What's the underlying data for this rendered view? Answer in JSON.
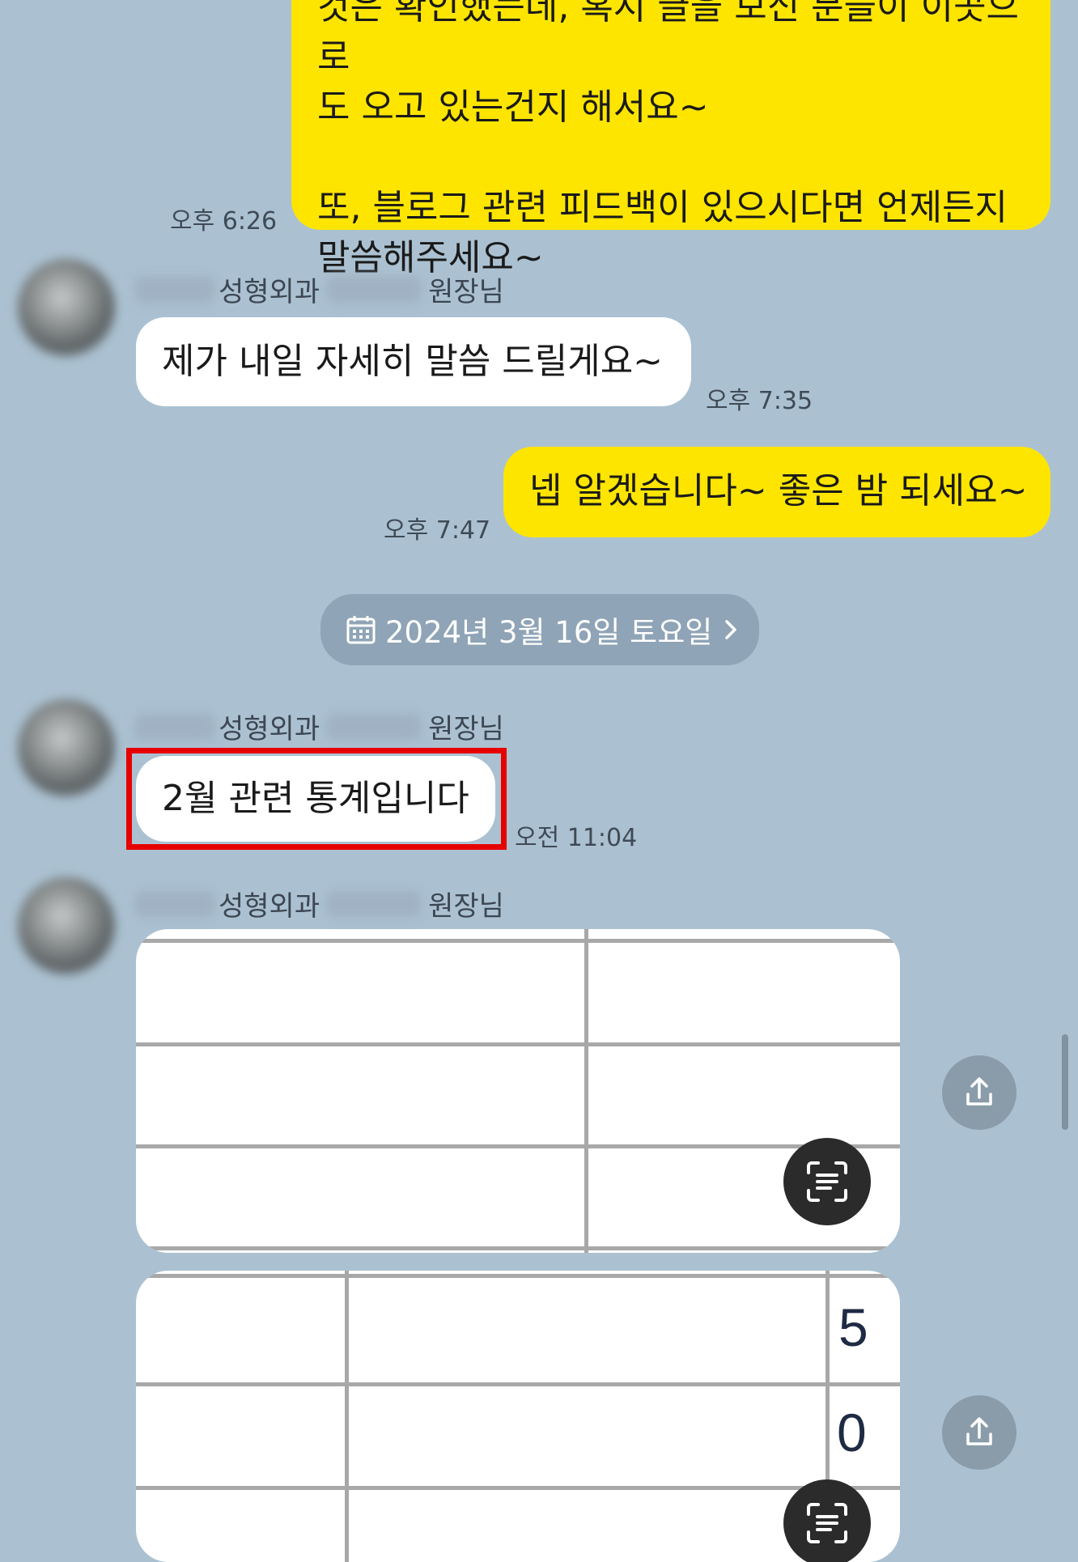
{
  "messages": {
    "m1": {
      "text": "것은 확인했는데, 혹시 글을 보신 분들이 이곳으로\n도 오고 있는건지 해서요~\n\n또, 블로그 관련 피드백이 있으시다면 언제든지\n말씀해주세요~",
      "time": "오후 6:26"
    },
    "m2": {
      "sender_clinic": "성형외과",
      "sender_title": "원장님",
      "text": "제가 내일 자세히 말씀 드릴게요~",
      "time": "오후 7:35"
    },
    "m3": {
      "text": "넵 알겠습니다~ 좋은 밤 되세요~",
      "time": "오후 7:47"
    },
    "date_divider": {
      "label": "2024년 3월 16일 토요일"
    },
    "m4": {
      "sender_clinic": "성형외과",
      "sender_title": "원장님",
      "text": "2월 관련 통계입니다",
      "time": "오전 11:04"
    },
    "m5": {
      "sender_clinic": "성형외과",
      "sender_title": "원장님",
      "sheet2_values": [
        "5",
        "0"
      ]
    }
  },
  "icons": {
    "calendar": "calendar-icon",
    "chevron": "chevron-right-icon",
    "share": "share-icon",
    "ocr": "text-scan-icon"
  },
  "colors": {
    "background": "#ABC1D1",
    "my_bubble": "#FEE500",
    "their_bubble": "#FFFFFF",
    "highlight": "#E60000"
  }
}
